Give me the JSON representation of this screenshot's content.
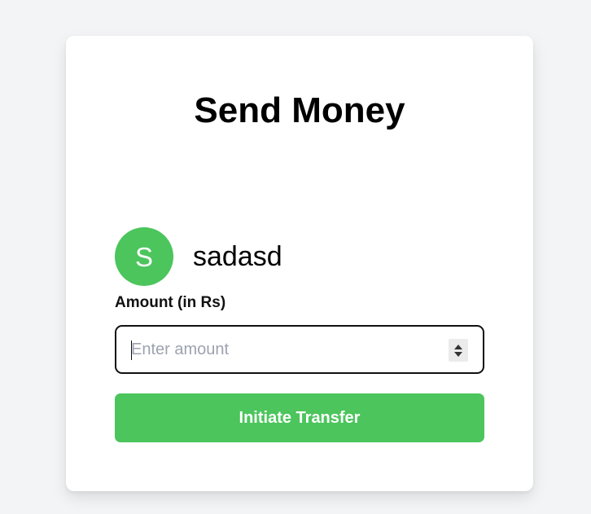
{
  "page": {
    "title": "Send Money"
  },
  "recipient": {
    "initial": "S",
    "name": "sadasd"
  },
  "amount": {
    "label": "Amount (in Rs)",
    "value": "",
    "placeholder": "Enter amount"
  },
  "actions": {
    "transfer_label": "Initiate Transfer"
  },
  "colors": {
    "page_background": "#f3f4f6",
    "accent": "#4bc55c",
    "card_background": "#ffffff"
  }
}
